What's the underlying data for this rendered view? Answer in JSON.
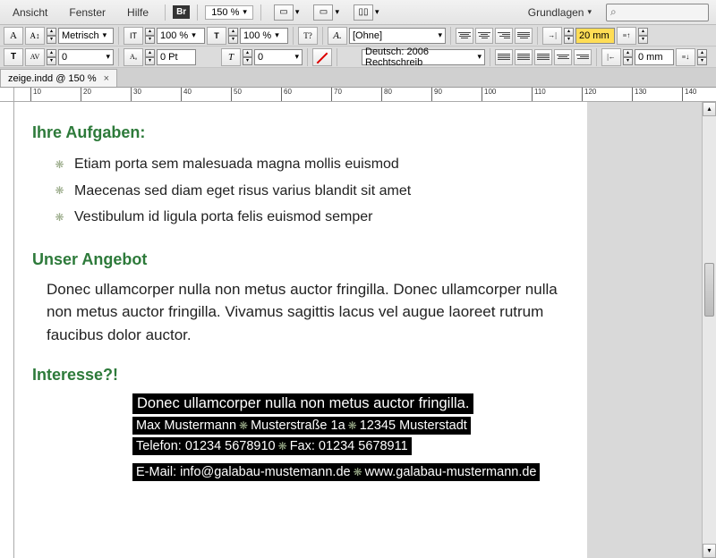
{
  "menubar": {
    "ansicht": "Ansicht",
    "fenster": "Fenster",
    "hilfe": "Hilfe",
    "br": "Br",
    "zoom": "150 %",
    "workspace": "Grundlagen"
  },
  "ctrl": {
    "metric": "Metrisch",
    "scale1": "100 %",
    "scale2": "100 %",
    "kern": "0",
    "leading": "0 Pt",
    "track": "0",
    "charStyle": "[Ohne]",
    "lang": "Deutsch: 2006 Rechtschreib",
    "indentHighlight": "20 mm",
    "indent2": "0 mm"
  },
  "tab": {
    "label": "zeige.indd @ 150 %"
  },
  "ruler": [
    "10",
    "20",
    "30",
    "40",
    "50",
    "60",
    "70",
    "80",
    "90",
    "100",
    "110",
    "120",
    "130",
    "140"
  ],
  "doc": {
    "h1": "Ihre Aufgaben:",
    "bullets": [
      "Etiam porta sem malesuada magna mollis euismod",
      "Maecenas sed diam eget risus varius blandit sit amet",
      "Vestibulum id ligula porta felis euismod semper"
    ],
    "h2": "Unser Angebot",
    "para": "Donec ullamcorper nulla non metus auctor fringilla. Donec ullamcorper nulla non metus auctor fringilla. Vivamus sagittis lacus vel augue laoreet rutrum faucibus dolor auctor.",
    "h3": "Interesse?!",
    "contact": {
      "l1": "Donec ullamcorper nulla non metus auctor fringilla.",
      "l2a": "Max Mustermann",
      "l2b": "Musterstraße 1a",
      "l2c": "12345 Musterstadt",
      "l3a": "Telefon: 01234  5678910",
      "l3b": "Fax: 01234 5678911",
      "l4a": "E-Mail: info@galabau-mustemann.de",
      "l4b": "www.galabau-mustermann.de"
    }
  }
}
